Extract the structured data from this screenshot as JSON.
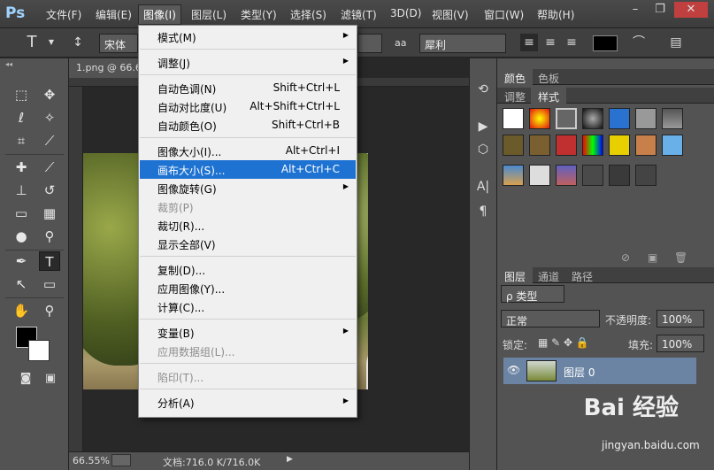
{
  "app": {
    "logo": "Ps"
  },
  "menubar": {
    "items": [
      "文件(F)",
      "编辑(E)",
      "图像(I)",
      "图层(L)",
      "类型(Y)",
      "选择(S)",
      "滤镜(T)",
      "3D(D)",
      "视图(V)",
      "窗口(W)",
      "帮助(H)"
    ],
    "active": "图像(I)"
  },
  "options": {
    "font_family": "宋体",
    "aa_label": "a",
    "aa_mode": "犀利"
  },
  "document": {
    "tab_title": "1.png @ 66.6",
    "zoom": "66.55%",
    "doc_info": "文档:716.0 K/716.0K"
  },
  "image_menu": {
    "items": [
      {
        "label": "模式(M)",
        "shortcut": "",
        "submenu": true,
        "disabled": false
      },
      {
        "sep": true
      },
      {
        "label": "调整(J)",
        "shortcut": "",
        "submenu": true,
        "disabled": false
      },
      {
        "sep": true
      },
      {
        "label": "自动色调(N)",
        "shortcut": "Shift+Ctrl+L",
        "submenu": false,
        "disabled": false
      },
      {
        "label": "自动对比度(U)",
        "shortcut": "Alt+Shift+Ctrl+L",
        "submenu": false,
        "disabled": false
      },
      {
        "label": "自动颜色(O)",
        "shortcut": "Shift+Ctrl+B",
        "submenu": false,
        "disabled": false
      },
      {
        "sep": true
      },
      {
        "label": "图像大小(I)...",
        "shortcut": "Alt+Ctrl+I",
        "submenu": false,
        "disabled": false
      },
      {
        "label": "画布大小(S)...",
        "shortcut": "Alt+Ctrl+C",
        "submenu": false,
        "disabled": false,
        "highlighted": true
      },
      {
        "label": "图像旋转(G)",
        "shortcut": "",
        "submenu": true,
        "disabled": false
      },
      {
        "label": "裁剪(P)",
        "shortcut": "",
        "submenu": false,
        "disabled": true
      },
      {
        "label": "裁切(R)...",
        "shortcut": "",
        "submenu": false,
        "disabled": false
      },
      {
        "label": "显示全部(V)",
        "shortcut": "",
        "submenu": false,
        "disabled": false
      },
      {
        "sep": true
      },
      {
        "label": "复制(D)...",
        "shortcut": "",
        "submenu": false,
        "disabled": false
      },
      {
        "label": "应用图像(Y)...",
        "shortcut": "",
        "submenu": false,
        "disabled": false
      },
      {
        "label": "计算(C)...",
        "shortcut": "",
        "submenu": false,
        "disabled": false
      },
      {
        "sep": true
      },
      {
        "label": "变量(B)",
        "shortcut": "",
        "submenu": true,
        "disabled": false
      },
      {
        "label": "应用数据组(L)...",
        "shortcut": "",
        "submenu": false,
        "disabled": true
      },
      {
        "sep": true
      },
      {
        "label": "陷印(T)...",
        "shortcut": "",
        "submenu": false,
        "disabled": true
      },
      {
        "sep": true
      },
      {
        "label": "分析(A)",
        "shortcut": "",
        "submenu": true,
        "disabled": false
      }
    ]
  },
  "panels": {
    "color_tabs": [
      "颜色",
      "色板"
    ],
    "style_tabs": [
      "调整",
      "样式"
    ],
    "layer_tabs": [
      "图层",
      "通道",
      "路径"
    ],
    "kind_filter": "ρ 类型",
    "blend_mode": "正常",
    "opacity_label": "不透明度:",
    "opacity_value": "100%",
    "lock_label": "锁定:",
    "fill_label": "填充:",
    "fill_value": "100%",
    "layer_name": "图层 0"
  },
  "watermark": {
    "brand": "Bai 经验",
    "url": "jingyan.baidu.com"
  }
}
